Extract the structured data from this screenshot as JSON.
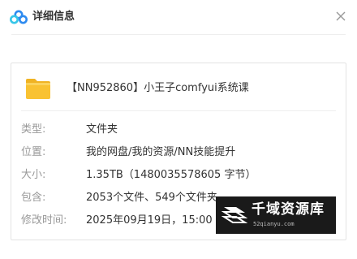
{
  "dialog": {
    "title": "详细信息",
    "icons": {
      "logo": "baidu-netdisk-logo-icon",
      "close": "close-icon"
    }
  },
  "file": {
    "name": "【NN952860】小王子comfyui系统课",
    "icon": "folder-icon",
    "icon_color": "#F9C232"
  },
  "properties": [
    {
      "label": "类型:",
      "value": "文件夹"
    },
    {
      "label": "位置:",
      "value": "我的网盘/我的资源/NN技能提升"
    },
    {
      "label": "大小:",
      "value": "1.35TB（1480035578605 字节）"
    },
    {
      "label": "包含:",
      "value": "2053个文件、549个文件夹"
    },
    {
      "label": "修改时间:",
      "value": "2025年09月19日，15:00"
    }
  ],
  "watermark": {
    "title": "千域资源库",
    "url": "52qianyu.com",
    "icon": "layered-stack-icon"
  },
  "colors": {
    "label": "#999999",
    "value": "#333333",
    "logo_blue": "#2E8BF0",
    "logo_cyan": "#36C6E8",
    "watermark_bg": "#1a1a1a"
  }
}
